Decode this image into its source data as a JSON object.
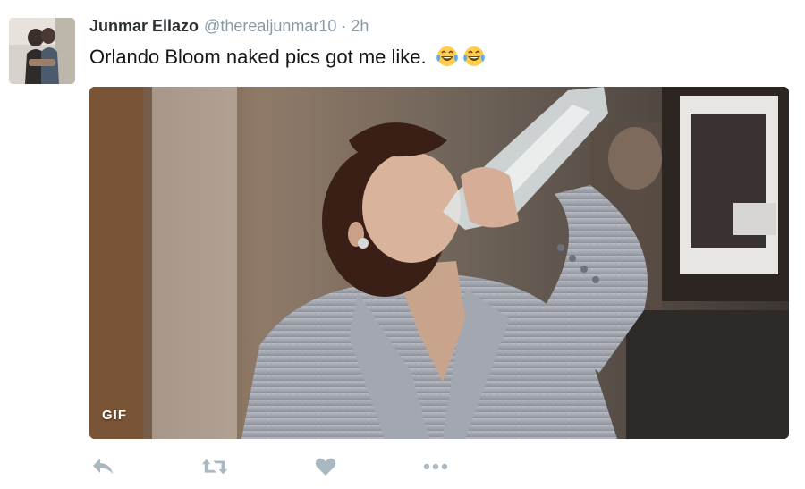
{
  "tweet": {
    "author": {
      "display_name": "Junmar Ellazo",
      "screen_name": "@therealjunmar10",
      "separator": "·",
      "timestamp": "2h",
      "avatar_icon": "user-photo"
    },
    "text": "Orlando Bloom naked pics got me like.",
    "emojis": [
      "face-with-tears-of-joy",
      "face-with-tears-of-joy"
    ],
    "media": {
      "type": "gif",
      "badge": "GIF",
      "description_icon": "woman-drinking-from-bottle"
    },
    "actions": [
      {
        "name": "reply",
        "icon": "reply-icon"
      },
      {
        "name": "retweet",
        "icon": "retweet-icon"
      },
      {
        "name": "like",
        "icon": "heart-icon"
      },
      {
        "name": "more",
        "icon": "more-icon"
      }
    ],
    "colors": {
      "name": "#292f33",
      "meta": "#8899a6",
      "text": "#14171a",
      "action_icon": "#aab8c2"
    }
  }
}
